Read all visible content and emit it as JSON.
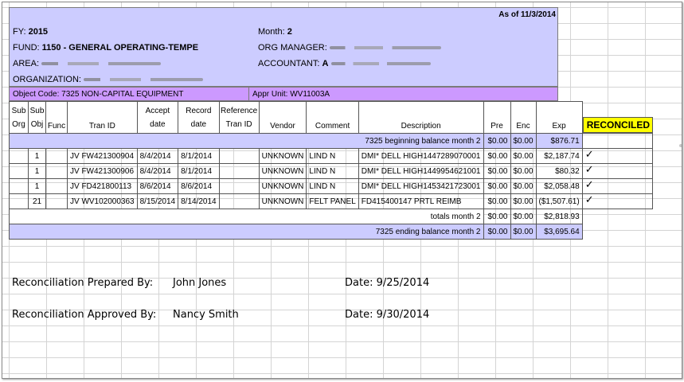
{
  "header": {
    "as_of": "As of 11/3/2014",
    "fy_label": "FY:",
    "fy_value": "2015",
    "month_label": "Month:",
    "month_value": "2",
    "fund_label": "FUND:",
    "fund_value": "1150  -  GENERAL OPERATING-TEMPE",
    "org_manager_label": "ORG MANAGER:",
    "area_label": "AREA:",
    "accountant_label": "ACCOUNTANT:",
    "accountant_initial": "A",
    "organization_label": "ORGANIZATION:"
  },
  "object_bar": {
    "object_code": "Object Code: 7325 NON-CAPITAL EQUIPMENT",
    "appr_unit": "Appr Unit: WV11003A"
  },
  "columns": {
    "sub_org": [
      "Sub",
      "Org"
    ],
    "sub_obj": [
      "Sub",
      "Obj"
    ],
    "func": "Func",
    "tran_id": "Tran ID",
    "accept_date": [
      "Accept",
      "date"
    ],
    "record_date": [
      "Record",
      "date"
    ],
    "ref_tran_id": [
      "Reference",
      "Tran ID"
    ],
    "vendor": "Vendor",
    "comment": "Comment",
    "description": "Description",
    "pre": "Pre",
    "enc": "Enc",
    "exp": "Exp"
  },
  "reconciled_label": "RECONCILED",
  "beginning": {
    "label": "7325 beginning balance month 2",
    "pre": "$0.00",
    "enc": "$0.00",
    "exp": "$876.71"
  },
  "rows": [
    {
      "sub_org": "",
      "sub_obj": "1",
      "func": "",
      "tran_id": "JV FW421300904",
      "accept": "8/4/2014",
      "record": "8/1/2014",
      "ref": "",
      "vendor": "UNKNOWN",
      "comment": "LIND N",
      "description": "DMI* DELL HIGH1447289070001",
      "pre": "$0.00",
      "enc": "$0.00",
      "exp": "$2,187.74",
      "check": "✓"
    },
    {
      "sub_org": "",
      "sub_obj": "1",
      "func": "",
      "tran_id": "JV FW421300906",
      "accept": "8/4/2014",
      "record": "8/1/2014",
      "ref": "",
      "vendor": "UNKNOWN",
      "comment": "LIND N",
      "description": "DMI* DELL HIGH1449954621001",
      "pre": "$0.00",
      "enc": "$0.00",
      "exp": "$80.32",
      "check": "✓"
    },
    {
      "sub_org": "",
      "sub_obj": "1",
      "func": "",
      "tran_id": "JV FD421800113",
      "accept": "8/6/2014",
      "record": "8/6/2014",
      "ref": "",
      "vendor": "UNKNOWN",
      "comment": "LIND N",
      "description": "DMI* DELL HIGH1453421723001",
      "pre": "$0.00",
      "enc": "$0.00",
      "exp": "$2,058.48",
      "check": "✓"
    },
    {
      "sub_org": "",
      "sub_obj": "21",
      "func": "",
      "tran_id": "JV WV102000363",
      "accept": "8/15/2014",
      "record": "8/14/2014",
      "ref": "",
      "vendor": "UNKNOWN",
      "comment": "FELT PANEL",
      "description": "FD415400147 PRTL REIMB",
      "pre": "$0.00",
      "enc": "$0.00",
      "exp": "($1,507.61)",
      "check": "✓"
    }
  ],
  "totals": {
    "label": "totals month 2",
    "pre": "$0.00",
    "enc": "$0.00",
    "exp": "$2,818.93"
  },
  "ending": {
    "label": "7325 ending balance month 2",
    "pre": "$0.00",
    "enc": "$0.00",
    "exp": "$3,695.64"
  },
  "signoff": {
    "prepared_label": "Reconciliation Prepared By:",
    "prepared_name": "John Jones",
    "prepared_date": "Date:  9/25/2014",
    "approved_label": "Reconciliation Approved By:",
    "approved_name": "Nancy Smith",
    "approved_date": "Date:  9/30/2014"
  },
  "colors": {
    "header_bg": "#ccccff",
    "object_bar_bg": "#cc99ff",
    "reconciled_bg": "#ffff00"
  }
}
